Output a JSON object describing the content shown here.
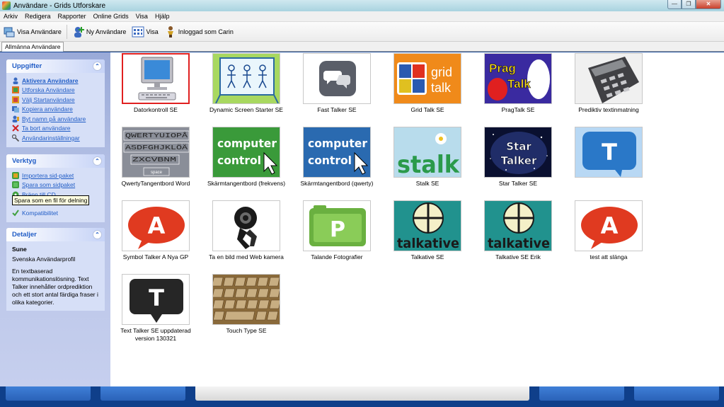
{
  "window": {
    "title": "Användare - Grids Utforskare",
    "minimize": "—",
    "maximize": "❐",
    "close": "✕"
  },
  "menu": [
    "Arkiv",
    "Redigera",
    "Rapporter",
    "Online Grids",
    "Visa",
    "Hjälp"
  ],
  "toolbar": {
    "show_users": "Visa Användare",
    "new_user": "Ny Användare",
    "view": "Visa",
    "logged_in": "Inloggad som Carin"
  },
  "tab": {
    "label": "Allmänna Användare"
  },
  "panels": {
    "tasks": {
      "title": "Uppgifter",
      "items": [
        "Aktivera Användare",
        "Utforska Användare",
        "Välj Startanvändare",
        "Kopiera användare",
        "Byt namn på användare",
        "Ta bort användare",
        "Användarinställningar"
      ]
    },
    "tools": {
      "title": "Verktyg",
      "items": [
        "Importera sid-paket",
        "Spara som sidpaket",
        "Bränn till CD",
        "Kompatibilitet"
      ]
    },
    "details": {
      "title": "Detaljer",
      "name": "Sune",
      "profile": "Svenska Användarprofil",
      "description": "En textbaserad kommunikationslösning. Text Talker innehåller ordprediktion och ett stort antal färdiga fraser i olika kategorier."
    }
  },
  "tooltip": "Spara som en fil för delning",
  "users": [
    {
      "name": "Datorkontroll SE",
      "thumb": "monitor-icon"
    },
    {
      "name": "Dynamic Screen Starter SE",
      "thumb": "stick-figures-icon"
    },
    {
      "name": "Fast Talker SE",
      "thumb": "speech-bubbles-icon"
    },
    {
      "name": "Grid Talk SE",
      "thumb": "grid-talk-logo",
      "text1": "grid",
      "text2": "talk"
    },
    {
      "name": "PragTalk SE",
      "thumb": "pragtalk-logo",
      "text1": "Prag",
      "text2": "Talk"
    },
    {
      "name": "Prediktiv textinmatning",
      "thumb": "phone-icon"
    },
    {
      "name": "QwertyTangentbord Word",
      "thumb": "keyboard-icon"
    },
    {
      "name": "Skärmtangentbord (frekvens)",
      "thumb": "computer-control-green",
      "text1": "computer",
      "text2": "control"
    },
    {
      "name": "Skärmtangentbord (qwerty)",
      "thumb": "computer-control-blue",
      "text1": "computer",
      "text2": "control"
    },
    {
      "name": "Stalk SE",
      "thumb": "stalk-logo",
      "text1": "stalk"
    },
    {
      "name": "Star Talker SE",
      "thumb": "star-talker-logo",
      "text1": "Star",
      "text2": "Talker"
    },
    {
      "name": "",
      "thumb": "t-bubble-blue-icon",
      "text1": "T"
    },
    {
      "name": "Symbol Talker A Nya GP",
      "thumb": "a-bubble-red-icon",
      "text1": "A"
    },
    {
      "name": "Ta en bild med Web kamera",
      "thumb": "webcam-icon"
    },
    {
      "name": "Talande Fotografier",
      "thumb": "camera-icon",
      "text1": "P"
    },
    {
      "name": "Talkative SE",
      "thumb": "talkative-logo",
      "text1": "talkative"
    },
    {
      "name": "Talkative SE Erik",
      "thumb": "talkative-logo",
      "text1": "talkative"
    },
    {
      "name": "test att slänga",
      "thumb": "a-bubble-red-icon",
      "text1": "A"
    },
    {
      "name": "Text Talker SE  uppdaterad version 130321",
      "thumb": "t-bubble-black-icon",
      "text1": "T"
    },
    {
      "name": "Touch Type SE",
      "thumb": "keyboard-photo-icon"
    }
  ],
  "keyboard_rows": [
    "QWERTYUIOPÅ",
    "ASDFGHJKLÖÄ",
    "ZXCVBNM"
  ],
  "keyboard_space": "space",
  "colors": {
    "accent": "#215dc6",
    "selection": "#e02020",
    "taskbar": "#0f3f8a",
    "talkative_teal": "#21928e"
  }
}
